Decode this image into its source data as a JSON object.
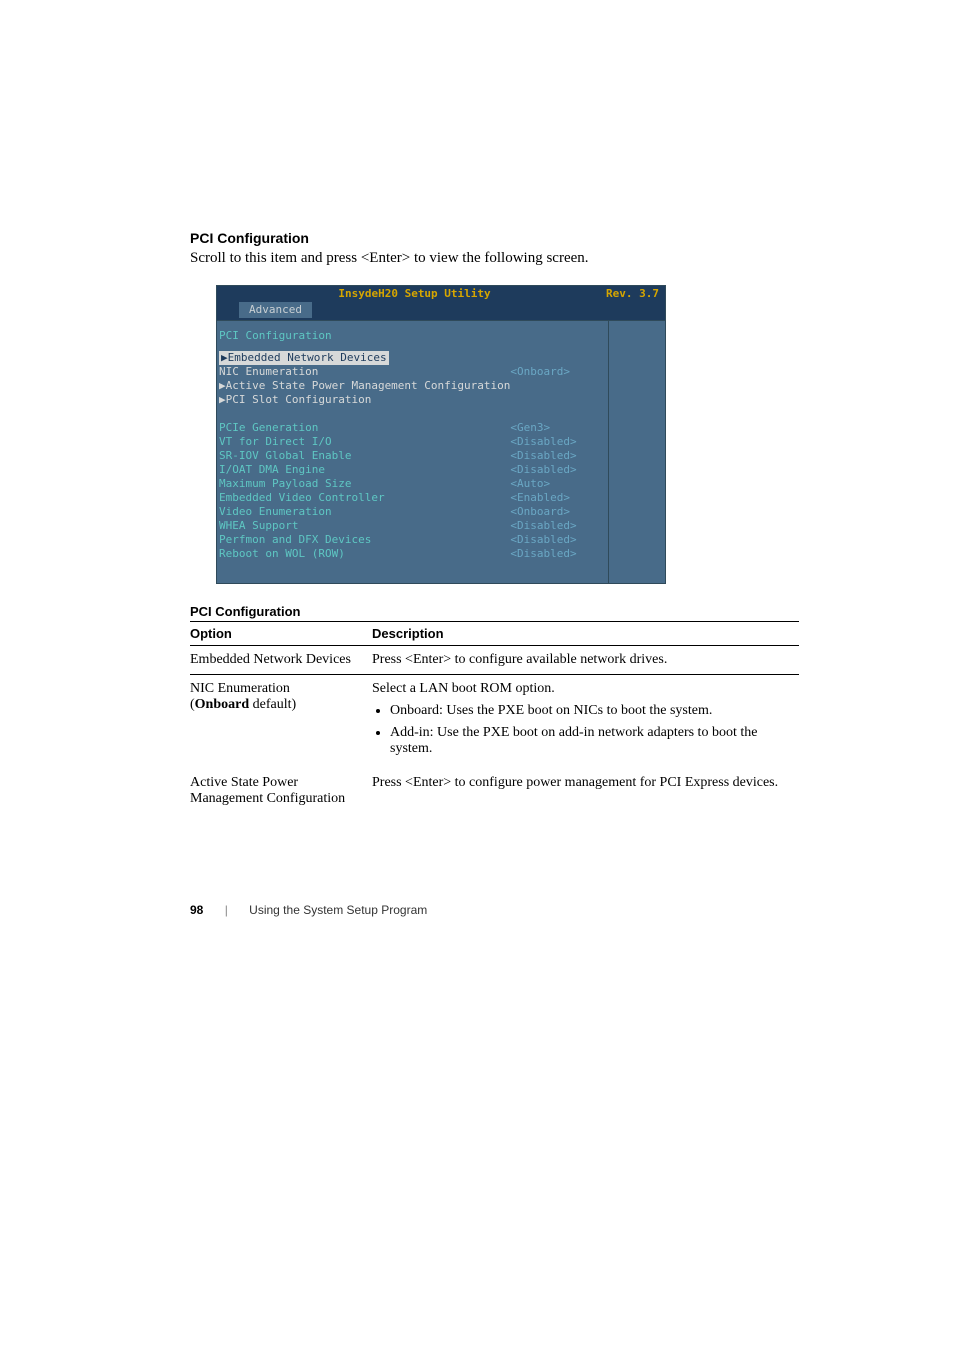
{
  "section": {
    "heading": "PCI Configuration",
    "intro": "Scroll to this item and press <Enter> to view the following screen."
  },
  "bios": {
    "title_center": "InsydeH20 Setup Utility",
    "title_right": "Rev. 3.7",
    "tab_label": "Advanced",
    "subheading": "PCI Configuration",
    "rows_upper": [
      {
        "label": "▶Embedded Network Devices",
        "value": "",
        "style": "hl"
      },
      {
        "label": "NIC Enumeration",
        "value": "<Onboard>",
        "style": "white"
      },
      {
        "label": "▶Active State Power Management Configuration",
        "value": "",
        "style": "white"
      },
      {
        "label": "▶PCI Slot Configuration",
        "value": "",
        "style": "white"
      }
    ],
    "rows_lower": [
      {
        "label": "PCIe Generation",
        "value": "<Gen3>",
        "style": "teal"
      },
      {
        "label": "VT for Direct I/O",
        "value": "<Disabled>",
        "style": "teal"
      },
      {
        "label": "SR-IOV Global Enable",
        "value": "<Disabled>",
        "style": "teal"
      },
      {
        "label": "I/OAT DMA Engine",
        "value": "<Disabled>",
        "style": "teal"
      },
      {
        "label": "Maximum Payload Size",
        "value": "<Auto>",
        "style": "teal"
      },
      {
        "label": "Embedded Video Controller",
        "value": "<Enabled>",
        "style": "teal"
      },
      {
        "label": "Video Enumeration",
        "value": "<Onboard>",
        "style": "teal"
      },
      {
        "label": "WHEA Support",
        "value": "<Disabled>",
        "style": "teal"
      },
      {
        "label": "Perfmon and DFX Devices",
        "value": "<Disabled>",
        "style": "teal"
      },
      {
        "label": "Reboot on WOL (ROW)",
        "value": "<Disabled>",
        "style": "teal"
      }
    ]
  },
  "table": {
    "caption": "PCI Configuration",
    "headers": {
      "option": "Option",
      "description": "Description"
    },
    "rows": [
      {
        "option_text": "Embedded Network Devices",
        "option_note": "",
        "option_bold": "",
        "desc_lead": "Press <Enter> to configure available network drives.",
        "bullets": []
      },
      {
        "option_text": "NIC Enumeration",
        "option_note_prefix": "(",
        "option_bold": "Onboard",
        "option_note_suffix": " default)",
        "desc_lead": "Select a LAN boot ROM option.",
        "bullets": [
          "Onboard: Uses the PXE boot on NICs to boot the system.",
          "Add-in: Use the PXE boot on add-in network adapters to boot the system."
        ]
      },
      {
        "option_text": "Active State Power Management Configuration",
        "option_note": "",
        "option_bold": "",
        "desc_lead": "Press <Enter> to configure power management for PCI Express devices.",
        "bullets": []
      }
    ]
  },
  "footer": {
    "page": "98",
    "chapter": "Using the System Setup Program"
  }
}
